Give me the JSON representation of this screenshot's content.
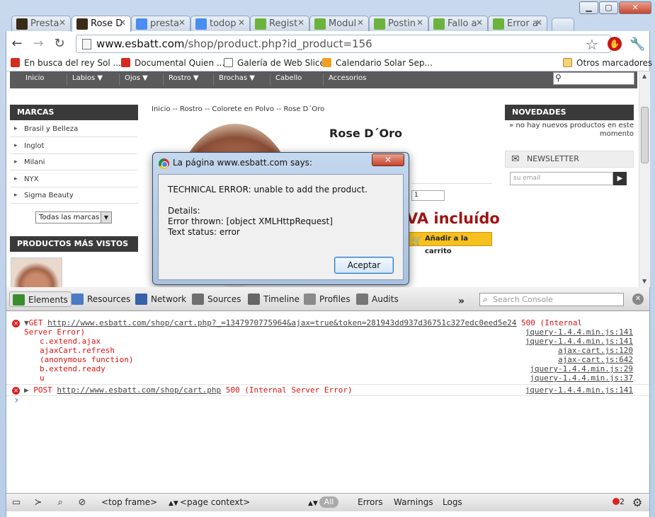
{
  "tabs": [
    {
      "label": "Presta",
      "active": false,
      "icon": "es-icon",
      "color": "#3b2a1a"
    },
    {
      "label": "Rose D",
      "active": true,
      "icon": "es-icon",
      "color": "#3b2a1a"
    },
    {
      "label": "presta",
      "active": false,
      "icon": "google-icon",
      "color": "#4a8df0"
    },
    {
      "label": "todop",
      "active": false,
      "icon": "google-icon",
      "color": "#4a8df0"
    },
    {
      "label": "Regist",
      "active": false,
      "icon": "puzzle-icon",
      "color": "#6cb33e"
    },
    {
      "label": "Modul",
      "active": false,
      "icon": "puzzle-icon",
      "color": "#6cb33e"
    },
    {
      "label": "Postin",
      "active": false,
      "icon": "puzzle-icon",
      "color": "#6cb33e"
    },
    {
      "label": "Fallo a",
      "active": false,
      "icon": "puzzle-icon",
      "color": "#6cb33e"
    },
    {
      "label": "Error a",
      "active": false,
      "icon": "puzzle-icon",
      "color": "#6cb33e"
    }
  ],
  "omnibox": {
    "host": "www.esbatt.com",
    "path": "/shop/product.php?id_product=156"
  },
  "bookmarks": [
    {
      "label": "En busca del rey Sol ...",
      "icon": "youtube-icon",
      "color": "#d52b1e"
    },
    {
      "label": "Documental Quien ...",
      "icon": "youtube-icon",
      "color": "#d52b1e"
    },
    {
      "label": "Galería de Web Slice",
      "icon": "page-icon",
      "color": "#ffffff"
    },
    {
      "label": "Calendario Solar Sep...",
      "icon": "sun-icon",
      "color": "#f0a020"
    }
  ],
  "other_bookmarks": "Otros marcadores",
  "site": {
    "menu": [
      "Inicio",
      "Labios ▼",
      "Ojos ▼",
      "Rostro ▼",
      "Brochas ▼",
      "Cabello",
      "Accesorios"
    ],
    "marcas_title": "MARCAS",
    "marcas": [
      "Brasil y Belleza",
      "Inglot",
      "Milani",
      "NYX",
      "Sigma Beauty"
    ],
    "marcas_select": "Todas las marcas",
    "mas_vistos_title": "PRODUCTOS MÁS VISTOS",
    "breadcrumb": "Inicio  --  Rostro  -- Colorete en Polvo  -- Rose D´Oro",
    "product_title": "Rose D´Oro",
    "quantity": "1",
    "price_suffix": "VA incluído",
    "add_to_cart": "Añadir a la carrito",
    "novedades_title": "NOVEDADES",
    "novedades_text_1": "» no hay nuevos productos en este",
    "novedades_text_2": "momento",
    "newsletter_title": "NEWSLETTER",
    "newsletter_placeholder": "su email"
  },
  "dialog": {
    "title": "La página www.esbatt.com says:",
    "close": "✕",
    "line1": "TECHNICAL ERROR: unable to add the product.",
    "line2": "Details:",
    "line3": "Error thrown: [object XMLHttpRequest]",
    "line4": "Text status: error",
    "ok": "Aceptar"
  },
  "devtools": {
    "tabs": [
      {
        "label": "Elements",
        "active": true,
        "icon": "elements-icon",
        "color": "#3c8c2f"
      },
      {
        "label": "Resources",
        "active": false,
        "icon": "resources-icon",
        "color": "#4a7bc4"
      },
      {
        "label": "Network",
        "active": false,
        "icon": "network-icon",
        "color": "#3761a8"
      },
      {
        "label": "Sources",
        "active": false,
        "icon": "sources-icon",
        "color": "#6f6f6f"
      },
      {
        "label": "Timeline",
        "active": false,
        "icon": "timeline-icon",
        "color": "#666666"
      },
      {
        "label": "Profiles",
        "active": false,
        "icon": "profiles-icon",
        "color": "#8a8a8a"
      },
      {
        "label": "Audits",
        "active": false,
        "icon": "audits-icon",
        "color": "#777777"
      }
    ],
    "more": "»",
    "search_placeholder": "Search Console",
    "console": {
      "get_prefix": "GET",
      "get_url": "http://www.esbatt.com/shop/cart.php?_=1347970775964&ajax=true&token=281943dd937d36751c327edc0eed5e24",
      "get_status_1": "500 (Internal",
      "get_status_2": "Server Error)",
      "stack": [
        {
          "fn": "c.extend.ajax",
          "src": "jquery-1.4.4.min.js:141"
        },
        {
          "fn": "ajaxCart.refresh",
          "src": "ajax-cart.js:120"
        },
        {
          "fn": "(anonymous function)",
          "src": "ajax-cart.js:642"
        },
        {
          "fn": "b.extend.ready",
          "src": "jquery-1.4.4.min.js:29"
        },
        {
          "fn": "u",
          "src": "jquery-1.4.4.min.js:37"
        }
      ],
      "get_src": "jquery-1.4.4.min.js:141",
      "post_prefix": "POST",
      "post_url": "http://www.esbatt.com/shop/cart.php",
      "post_status": "500 (Internal Server Error)",
      "post_src": "jquery-1.4.4.min.js:141",
      "prompt": "›"
    },
    "status": {
      "frame": "<top frame>",
      "context": "<page context>",
      "all": "All",
      "errors": "Errors",
      "warnings": "Warnings",
      "logs": "Logs",
      "error_count": "2"
    }
  }
}
